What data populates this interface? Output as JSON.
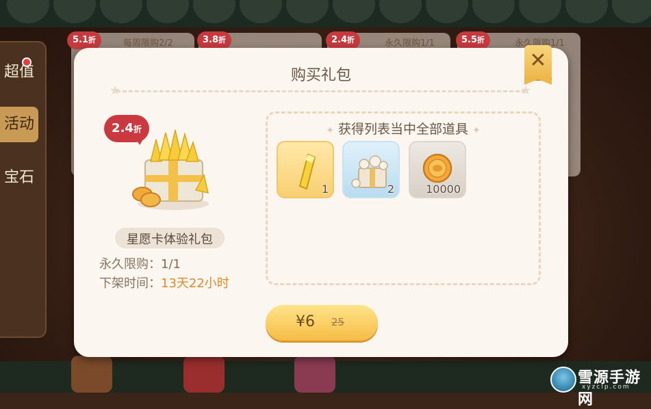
{
  "background": {
    "side_tabs": [
      "超值",
      "活动",
      "宝石"
    ],
    "active_tab_index": 1,
    "shop_cards": [
      {
        "discount": "5.1",
        "discount_unit": "折",
        "limit": "每周限购2/2"
      },
      {
        "discount": "3.8",
        "discount_unit": "折",
        "limit": ""
      },
      {
        "discount": "2.4",
        "discount_unit": "折",
        "limit": "永久限购1/1"
      },
      {
        "discount": "5.5",
        "discount_unit": "折",
        "limit": "永久限购1/1"
      }
    ]
  },
  "dialog": {
    "title": "购买礼包",
    "close_label": "✕",
    "package": {
      "discount_value": "2.4",
      "discount_unit": "折",
      "name": "星愿卡体验礼包",
      "limit_label": "永久限购：",
      "limit_value": "1/1",
      "expire_label": "下架时间：",
      "expire_value": "13天22小时"
    },
    "rewards": {
      "title": "获得列表当中全部道具",
      "items": [
        {
          "icon": "star-crystal-icon",
          "count": "1",
          "bg": "gold"
        },
        {
          "icon": "gift-box-icon",
          "count": "2",
          "bg": "blue"
        },
        {
          "icon": "gold-coin-icon",
          "count": "10000",
          "bg": "grey"
        }
      ]
    },
    "price": {
      "currency": "¥",
      "current": "6",
      "original": "25"
    }
  },
  "watermark": {
    "title": "雪源手游网",
    "url": "xyzclp.com"
  },
  "colors": {
    "accent_gold": "#f5bd45",
    "discount_red": "#c9393f",
    "expire_orange": "#e08a2c",
    "dialog_bg": "#fbf6ef"
  }
}
